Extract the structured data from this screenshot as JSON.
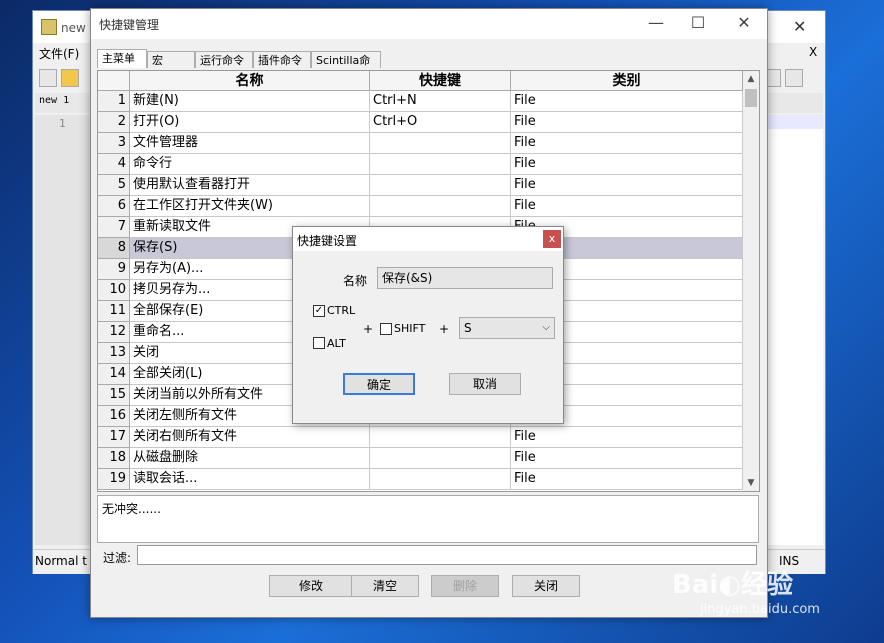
{
  "background_window": {
    "title": "new",
    "menu_file": "文件(F)",
    "menu_right": "X",
    "doc_tab": "new 1",
    "line_number": "1",
    "status_left": "Normal t",
    "status_right": "INS"
  },
  "shortcut_mapper": {
    "title": "快捷键管理",
    "controls": {
      "minimize": "—",
      "maximize": "☐",
      "close": "✕"
    },
    "tabs": [
      "主菜单",
      "宏",
      "运行命令",
      "插件命令",
      "Scintilla命令"
    ],
    "columns": [
      "名称",
      "快捷键",
      "类别"
    ],
    "rows": [
      {
        "num": "1",
        "name": "新建(N)",
        "shortcut": "Ctrl+N",
        "category": "File"
      },
      {
        "num": "2",
        "name": "打开(O)",
        "shortcut": "Ctrl+O",
        "category": "File"
      },
      {
        "num": "3",
        "name": "文件管理器",
        "shortcut": "",
        "category": "File"
      },
      {
        "num": "4",
        "name": "命令行",
        "shortcut": "",
        "category": "File"
      },
      {
        "num": "5",
        "name": "使用默认查看器打开",
        "shortcut": "",
        "category": "File"
      },
      {
        "num": "6",
        "name": "在工作区打开文件夹(W)",
        "shortcut": "",
        "category": "File"
      },
      {
        "num": "7",
        "name": "重新读取文件",
        "shortcut": "",
        "category": "File"
      },
      {
        "num": "8",
        "name": "保存(S)",
        "shortcut": "",
        "category": ""
      },
      {
        "num": "9",
        "name": "另存为(A)...",
        "shortcut": "",
        "category": ""
      },
      {
        "num": "10",
        "name": "拷贝另存为...",
        "shortcut": "",
        "category": ""
      },
      {
        "num": "11",
        "name": "全部保存(E)",
        "shortcut": "",
        "category": ""
      },
      {
        "num": "12",
        "name": "重命名...",
        "shortcut": "",
        "category": ""
      },
      {
        "num": "13",
        "name": "关闭",
        "shortcut": "",
        "category": ""
      },
      {
        "num": "14",
        "name": "全部关闭(L)",
        "shortcut": "",
        "category": ""
      },
      {
        "num": "15",
        "name": "关闭当前以外所有文件",
        "shortcut": "",
        "category": ""
      },
      {
        "num": "16",
        "name": "关闭左侧所有文件",
        "shortcut": "",
        "category": ""
      },
      {
        "num": "17",
        "name": "关闭右侧所有文件",
        "shortcut": "",
        "category": "File"
      },
      {
        "num": "18",
        "name": "从磁盘删除",
        "shortcut": "",
        "category": "File"
      },
      {
        "num": "19",
        "name": "读取会话...",
        "shortcut": "",
        "category": "File"
      }
    ],
    "conflict_text": "无冲突......",
    "filter_label": "过滤:",
    "filter_value": "",
    "buttons": {
      "modify": "修改",
      "clear": "清空",
      "delete": "删除",
      "close": "关闭"
    }
  },
  "shortcut_dialog": {
    "title": "快捷键设置",
    "close": "x",
    "name_label": "名称",
    "name_value": "保存(&S)",
    "ctrl_label": "CTRL",
    "ctrl_checked": true,
    "alt_label": "ALT",
    "alt_checked": false,
    "shift_label": "SHIFT",
    "shift_checked": false,
    "plus1": "+",
    "plus2": "+",
    "key_value": "S",
    "ok": "确定",
    "cancel": "取消"
  },
  "watermark": {
    "logo": "Bai经验",
    "sub": "jingyan.baidu.com"
  }
}
